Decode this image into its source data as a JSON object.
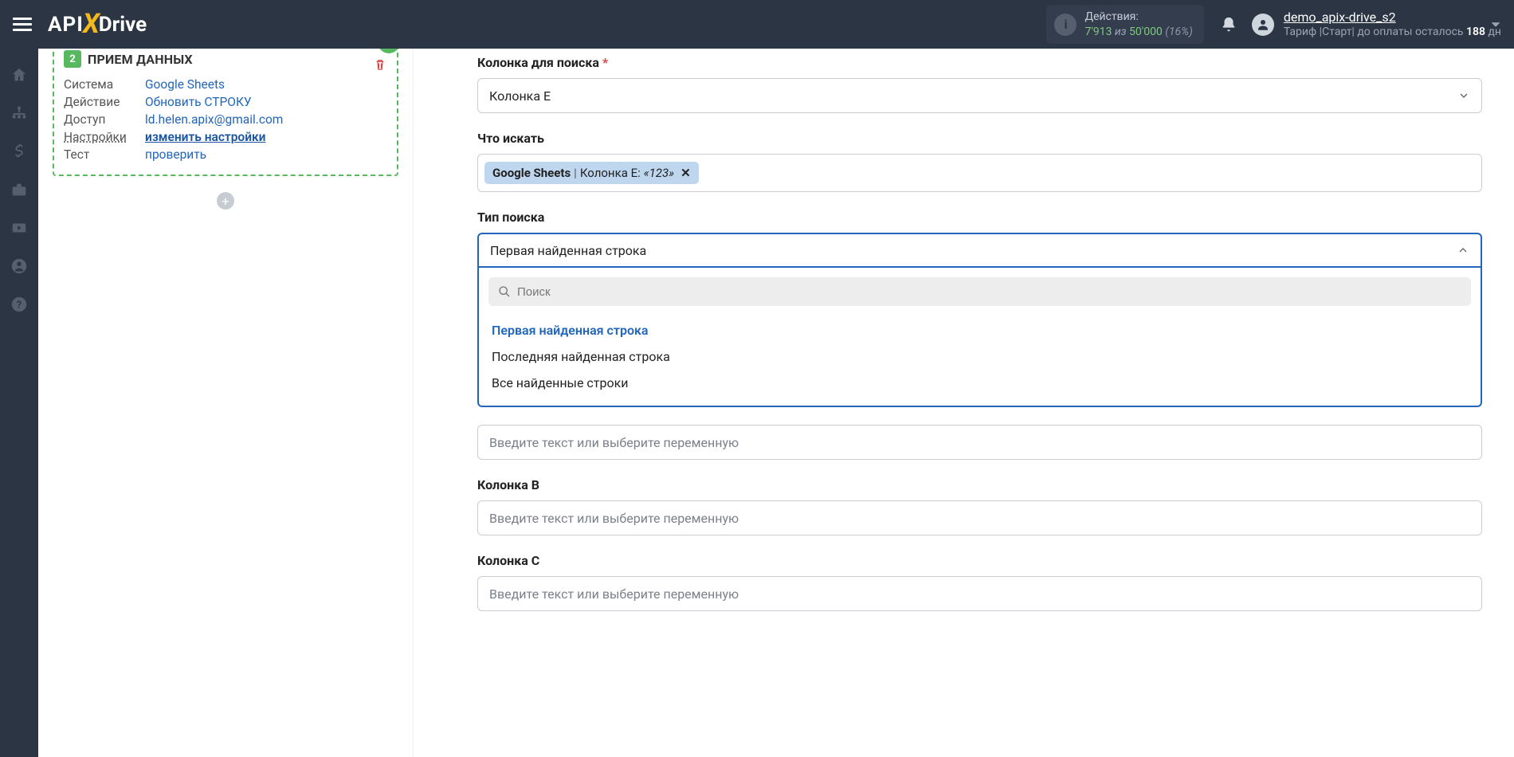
{
  "header": {
    "logo": {
      "api": "API",
      "x": "X",
      "drive": "Drive"
    },
    "actions": {
      "label": "Действия:",
      "count1": "7'913",
      "iz": " из ",
      "count2": "50'000",
      "pct": " (16%)"
    },
    "user": {
      "name": "demo_apix-drive_s2",
      "plan_prefix": "Тариф |Старт| до оплаты осталось ",
      "plan_days": "188",
      "plan_suffix": " дн"
    }
  },
  "step": {
    "num": "2",
    "title": "ПРИЕМ ДАННЫХ",
    "rows": {
      "system_lbl": "Система",
      "system_val": "Google Sheets",
      "action_lbl": "Действие",
      "action_val": "Обновить СТРОКУ",
      "access_lbl": "Доступ",
      "access_val": "ld.helen.apix@gmail.com",
      "settings_lbl": "Настройки",
      "settings_val": "изменить настройки",
      "test_lbl": "Тест",
      "test_val": "проверить"
    }
  },
  "form": {
    "search_column": {
      "label": "Колонка для поиска",
      "value": "Колонка E"
    },
    "what_search": {
      "label": "Что искать",
      "tag": {
        "source": "Google Sheets",
        "sep": " | ",
        "col": "Колонка E: ",
        "val": "«123»"
      }
    },
    "search_type": {
      "label": "Тип поиска",
      "value": "Первая найденная строка",
      "search_placeholder": "Поиск",
      "options": [
        "Первая найденная строка",
        "Последняя найденная строка",
        "Все найденные строки"
      ]
    },
    "placeholder": "Введите текст или выберите переменную",
    "col_b": "Колонка B",
    "col_c": "Колонка C"
  }
}
